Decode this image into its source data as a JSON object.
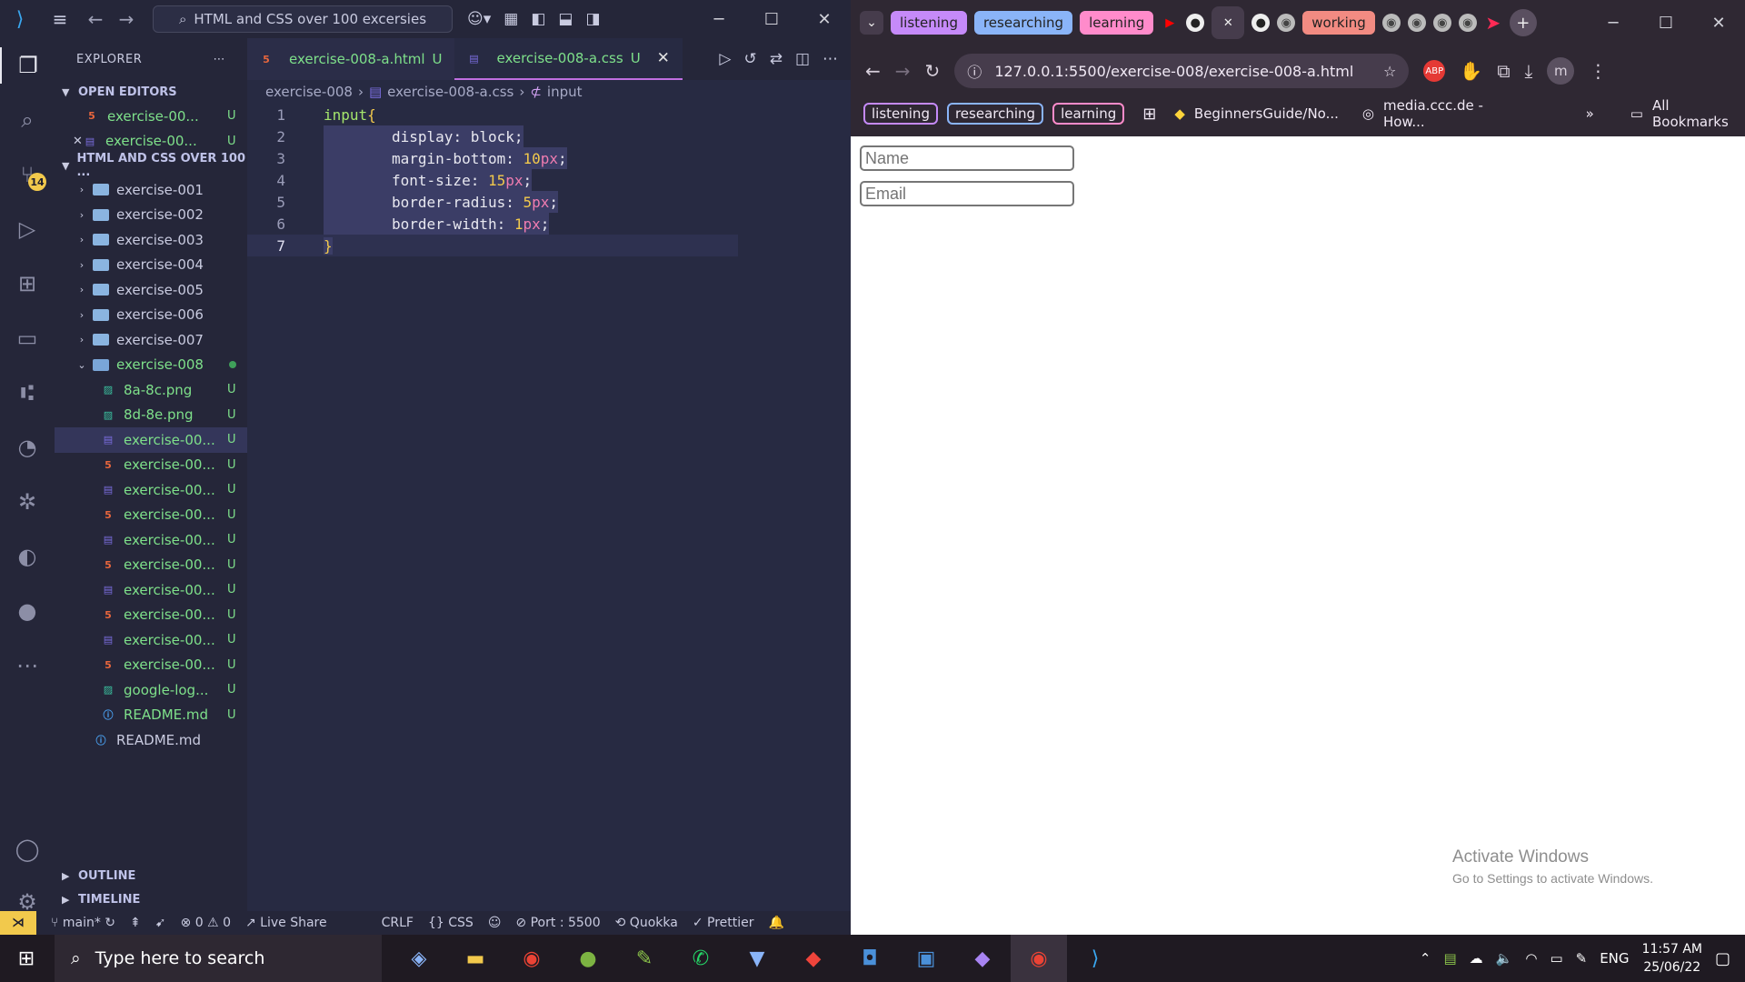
{
  "vscode": {
    "search_text": "HTML and CSS over 100 excersies",
    "explorer_title": "EXPLORER",
    "open_editors_label": "OPEN EDITORS",
    "open_editors": [
      {
        "name": "exercise-00...",
        "status": "U",
        "type": "html"
      },
      {
        "name": "exercise-00...",
        "status": "U",
        "type": "css"
      }
    ],
    "workspace_label": "HTML AND CSS OVER 100 ...",
    "folders": [
      "exercise-001",
      "exercise-002",
      "exercise-003",
      "exercise-004",
      "exercise-005",
      "exercise-006",
      "exercise-007"
    ],
    "open_folder": "exercise-008",
    "files": [
      {
        "name": "8a-8c.png",
        "status": "U",
        "type": "png"
      },
      {
        "name": "8d-8e.png",
        "status": "U",
        "type": "png"
      },
      {
        "name": "exercise-00...",
        "status": "U",
        "type": "css"
      },
      {
        "name": "exercise-00...",
        "status": "U",
        "type": "html"
      },
      {
        "name": "exercise-00...",
        "status": "U",
        "type": "css"
      },
      {
        "name": "exercise-00...",
        "status": "U",
        "type": "html"
      },
      {
        "name": "exercise-00...",
        "status": "U",
        "type": "css"
      },
      {
        "name": "exercise-00...",
        "status": "U",
        "type": "html"
      },
      {
        "name": "exercise-00...",
        "status": "U",
        "type": "css"
      },
      {
        "name": "exercise-00...",
        "status": "U",
        "type": "html"
      },
      {
        "name": "exercise-00...",
        "status": "U",
        "type": "css"
      },
      {
        "name": "exercise-00...",
        "status": "U",
        "type": "html"
      },
      {
        "name": "google-log...",
        "status": "U",
        "type": "png"
      },
      {
        "name": "README.md",
        "status": "U",
        "type": "info"
      }
    ],
    "root_readme": "README.md",
    "outline_label": "OUTLINE",
    "timeline_label": "TIMELINE",
    "scm_badge": "14",
    "tabs": [
      {
        "name": "exercise-008-a.html",
        "status": "U"
      },
      {
        "name": "exercise-008-a.css",
        "status": "U"
      }
    ],
    "breadcrumb": [
      "exercise-008",
      "exercise-008-a.css",
      "input"
    ],
    "code_lines": [
      {
        "n": "1"
      },
      {
        "n": "2",
        "prop": "display",
        "val": "block"
      },
      {
        "n": "3",
        "prop": "margin-bottom",
        "num": "10",
        "unit": "px"
      },
      {
        "n": "4",
        "prop": "font-size",
        "num": "15",
        "unit": "px"
      },
      {
        "n": "5",
        "prop": "border-radius",
        "num": "5",
        "unit": "px"
      },
      {
        "n": "6",
        "prop": "border-width",
        "num": "1",
        "unit": "px"
      },
      {
        "n": "7"
      }
    ],
    "selector": "input",
    "open_brace": "{",
    "close_brace": "}",
    "status": {
      "branch": "main*",
      "errors": "0",
      "warnings": "0",
      "live_share": "Live Share",
      "eol": "CRLF",
      "language": "CSS",
      "port": "Port : 5500",
      "quokka": "Quokka",
      "prettier": "Prettier"
    }
  },
  "chrome": {
    "tab_groups": [
      {
        "label": "listening",
        "color": "#c58af9"
      },
      {
        "label": "researching",
        "color": "#8ab4f8"
      },
      {
        "label": "learning",
        "color": "#ff8bcb"
      },
      {
        "label": "working",
        "color": "#f28b82"
      }
    ],
    "url": "127.0.0.1:5500/exercise-008/exercise-008-a.html",
    "bookmark_groups": [
      {
        "label": "listening",
        "color": "#c58af9"
      },
      {
        "label": "researching",
        "color": "#8ab4f8"
      },
      {
        "label": "learning",
        "color": "#ff8bcb"
      }
    ],
    "bookmarks": [
      "BeginnersGuide/No...",
      "media.ccc.de - How..."
    ],
    "all_bookmarks": "All Bookmarks",
    "profile_initial": "m",
    "page": {
      "name_placeholder": "Name",
      "email_placeholder": "Email"
    },
    "watermark_title": "Activate Windows",
    "watermark_sub": "Go to Settings to activate Windows."
  },
  "taskbar": {
    "search_placeholder": "Type here to search",
    "language": "ENG",
    "time": "11:57 AM",
    "date": "25/06/22"
  }
}
